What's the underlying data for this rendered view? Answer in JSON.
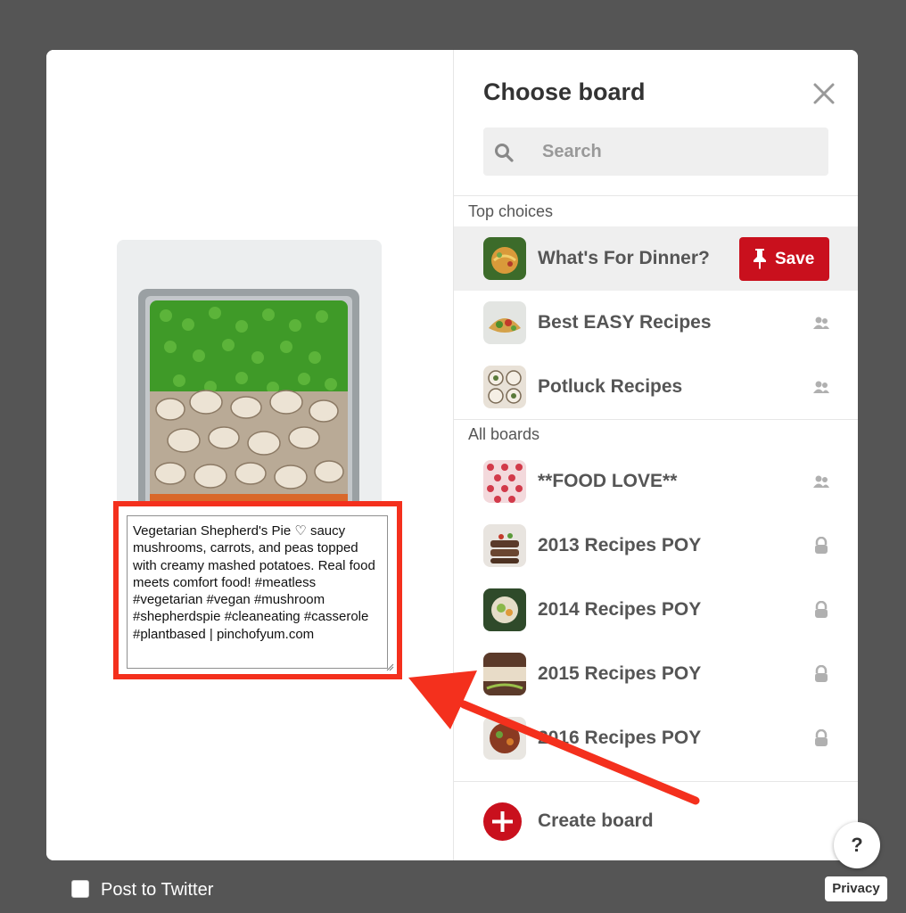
{
  "dialog": {
    "title": "Choose board",
    "search": {
      "placeholder": "Search",
      "value": ""
    }
  },
  "pin": {
    "description": "Vegetarian Shepherd's Pie ♡ saucy mushrooms, carrots, and peas topped with creamy mashed potatoes. Real food meets comfort food! #meatless #vegetarian #vegan #mushroom #shepherdspie #cleaneating #casserole #plantbased | pinchofyum.com"
  },
  "sections": {
    "top_choices": "Top choices",
    "all_boards": "All boards"
  },
  "top_boards": [
    {
      "name": "What's For Dinner?",
      "icon": "save-button",
      "highlighted": true
    },
    {
      "name": "Best EASY Recipes",
      "icon": "group-icon"
    },
    {
      "name": "Potluck Recipes",
      "icon": "group-icon"
    }
  ],
  "all_boards": [
    {
      "name": "**FOOD LOVE**",
      "icon": "group-icon"
    },
    {
      "name": "2013 Recipes POY",
      "icon": "lock-icon"
    },
    {
      "name": "2014 Recipes POY",
      "icon": "lock-icon"
    },
    {
      "name": "2015 Recipes POY",
      "icon": "lock-icon"
    },
    {
      "name": "2016 Recipes POY",
      "icon": "lock-icon"
    }
  ],
  "save_label": "Save",
  "create_board_label": "Create board",
  "footer": {
    "post_to_twitter": "Post to Twitter",
    "help": "?",
    "privacy": "Privacy"
  },
  "colors": {
    "backdrop": "#555555",
    "save_red": "#c9101d",
    "highlight_outline": "#f4301d",
    "text_gray": "#555555"
  }
}
